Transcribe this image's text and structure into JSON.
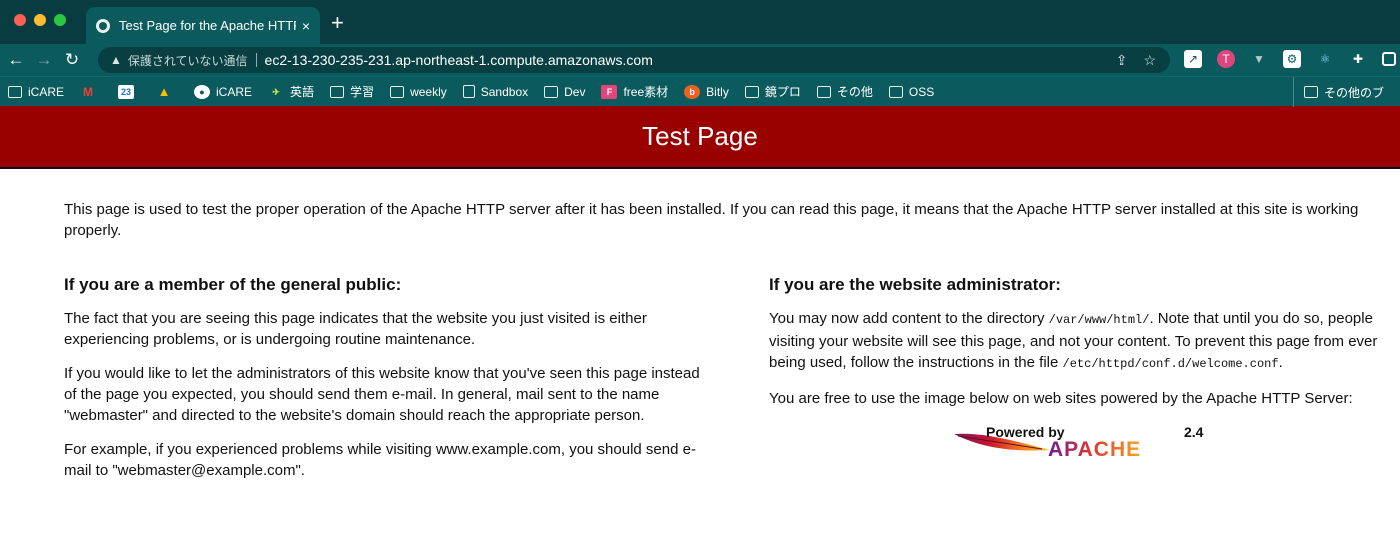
{
  "browser": {
    "tab_title": "Test Page for the Apache HTTP Server",
    "tab_close": "×",
    "new_tab": "+",
    "insecure_label": "保護されていない通信",
    "url": "ec2-13-230-235-231.ap-northeast-1.compute.amazonaws.com",
    "bookmarks": [
      {
        "label": "iCARE",
        "icon": "folder-icon"
      },
      {
        "label": "",
        "icon": "gmail-icon"
      },
      {
        "label": "",
        "icon": "calendar-icon",
        "badge": "23"
      },
      {
        "label": "",
        "icon": "drive-icon"
      },
      {
        "label": "iCARE",
        "icon": "github-icon"
      },
      {
        "label": "英語",
        "icon": "bird-icon"
      },
      {
        "label": "学習",
        "icon": "folder-icon"
      },
      {
        "label": "weekly",
        "icon": "folder-icon"
      },
      {
        "label": "Sandbox",
        "icon": "page-icon"
      },
      {
        "label": "Dev",
        "icon": "folder-icon"
      },
      {
        "label": "free素材",
        "icon": "f-icon",
        "badge": "F"
      },
      {
        "label": "Bitly",
        "icon": "bitly-icon",
        "badge": "b"
      },
      {
        "label": "鏡プロ",
        "icon": "folder-icon"
      },
      {
        "label": "その他",
        "icon": "folder-icon"
      },
      {
        "label": "OSS",
        "icon": "folder-icon"
      }
    ],
    "other_bookmarks": "その他のブ"
  },
  "page": {
    "banner_title": "Test Page",
    "intro": "This page is used to test the proper operation of the Apache HTTP server after it has been installed. If you can read this page, it means that the Apache HTTP server installed at this site is working properly.",
    "left": {
      "heading": "If you are a member of the general public:",
      "p1": "The fact that you are seeing this page indicates that the website you just visited is either experiencing problems, or is undergoing routine maintenance.",
      "p2": "If you would like to let the administrators of this website know that you've seen this page instead of the page you expected, you should send them e-mail. In general, mail sent to the name \"webmaster\" and directed to the website's domain should reach the appropriate person.",
      "p3": "For example, if you experienced problems while visiting www.example.com, you should send e-mail to \"webmaster@example.com\"."
    },
    "right": {
      "heading": "If you are the website administrator:",
      "p1_a": "You may now add content to the directory ",
      "p1_path": "/var/www/html/",
      "p1_b": ". Note that until you do so, people visiting your website will see this page, and not your content. To prevent this page from ever being used, follow the instructions in the file ",
      "p1_file": "/etc/httpd/conf.d/welcome.conf",
      "p1_c": ".",
      "p2": "You are free to use the image below on web sites powered by the Apache HTTP Server:",
      "logo_powered": "Powered by",
      "logo_word": "APACHE",
      "logo_version": "2.4"
    }
  }
}
